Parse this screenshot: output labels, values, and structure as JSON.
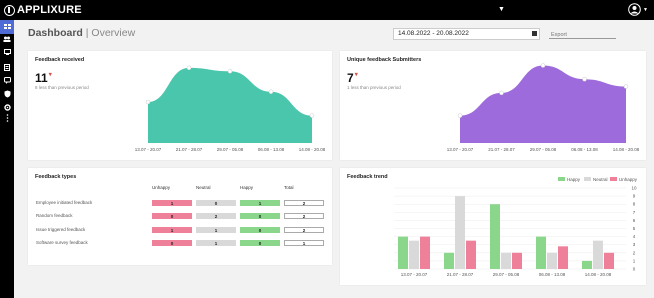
{
  "app": {
    "logo_text": "APPLIXURE"
  },
  "header": {
    "title": "Dashboard",
    "subtitle": "| Overview",
    "date_range": "14.08.2022 - 20.08.2022",
    "export_placeholder": "Export"
  },
  "colors": {
    "teal": "#49c6ac",
    "purple": "#9d6bdb",
    "unhappy": "#ef809a",
    "neutral": "#d9d9d9",
    "happy": "#8ad68a",
    "active_nav": "#4f6bd6"
  },
  "feedback_received": {
    "title": "Feedback received",
    "value": "11",
    "note": "8 less than previous period",
    "chart_data": {
      "type": "area",
      "categories": [
        "13.07 - 20.07",
        "21.07 - 28.07",
        "29.07 - 05.08",
        "06.08 - 13.08",
        "14.08 - 20.08"
      ],
      "values": [
        6,
        11,
        10.5,
        7.5,
        4
      ],
      "ylim": [
        0,
        12
      ]
    }
  },
  "unique_submitters": {
    "title": "Unique feedback Submitters",
    "value": "7",
    "note": "1 less than previous period",
    "chart_data": {
      "type": "area",
      "categories": [
        "13.07 - 20.07",
        "21.07 - 28.07",
        "29.07 - 05.08",
        "06.08 - 13.08",
        "14.08 - 20.08"
      ],
      "values": [
        3,
        5.5,
        8.5,
        7,
        6.2
      ],
      "ylim": [
        0,
        9
      ]
    }
  },
  "feedback_types": {
    "title": "Feedback types",
    "headers": [
      "Unhappy",
      "Neutral",
      "Happy",
      "Total"
    ],
    "rows": [
      {
        "label": "Employee initiated feedback",
        "unhappy": "1",
        "neutral": "0",
        "happy": "1",
        "total": "2"
      },
      {
        "label": "Random feedback",
        "unhappy": "0",
        "neutral": "2",
        "happy": "0",
        "total": "2"
      },
      {
        "label": "Issue triggered feedback",
        "unhappy": "1",
        "neutral": "1",
        "happy": "0",
        "total": "2"
      },
      {
        "label": "Software survey feedback",
        "unhappy": "0",
        "neutral": "1",
        "happy": "0",
        "total": "1"
      }
    ]
  },
  "feedback_trend": {
    "title": "Feedback trend",
    "chart_data": {
      "type": "bar",
      "categories": [
        "13.07 - 20.07",
        "21.07 - 28.07",
        "29.07 - 05.08",
        "06.08 - 13.08",
        "14.08 - 20.08"
      ],
      "series": [
        {
          "name": "Happy",
          "values": [
            4,
            2,
            8,
            4,
            1
          ]
        },
        {
          "name": "Neutral",
          "values": [
            3.5,
            9,
            2,
            2,
            3.5
          ]
        },
        {
          "name": "Unhappy",
          "values": [
            4,
            3.5,
            2,
            2.8,
            2
          ]
        }
      ],
      "ylim": [
        0,
        10
      ],
      "yticks": [
        "0",
        "1",
        "2",
        "3",
        "4",
        "5",
        "6",
        "7",
        "8",
        "9",
        "10"
      ],
      "legend": "top-right"
    }
  }
}
